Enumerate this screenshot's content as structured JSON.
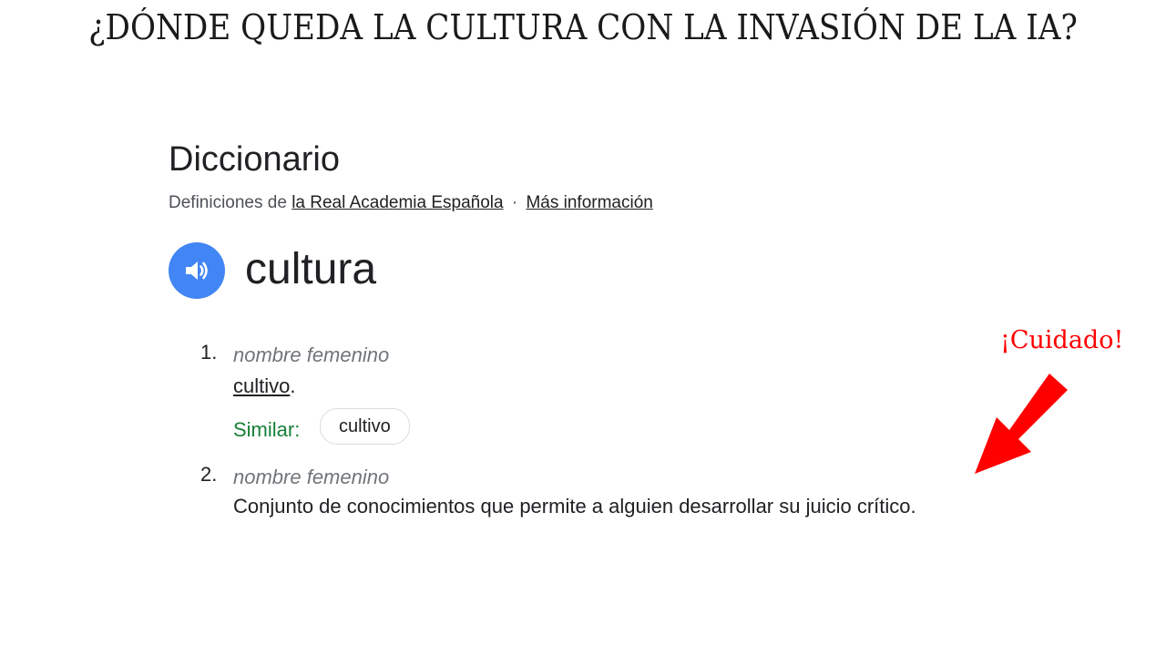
{
  "slide": {
    "title": "¿DÓNDE QUEDA LA CULTURA CON LA INVASIÓN DE LA IA?"
  },
  "dictionary": {
    "heading": "Diccionario",
    "source_prefix": "Definiciones de",
    "source_link": "la Real Academia Española",
    "separator": "·",
    "more_info_link": "Más información",
    "audio_icon": "speaker-icon",
    "audio_color": "#4285f4",
    "word": "cultura",
    "senses": [
      {
        "number": "1.",
        "part_of_speech": "nombre femenino",
        "definition_link": "cultivo",
        "definition_suffix": ".",
        "similar_label": "Similar:",
        "similar_chip": "cultivo"
      },
      {
        "number": "2.",
        "part_of_speech": "nombre femenino",
        "definition": "Conjunto de conocimientos que permite a alguien desarrollar su juicio crítico."
      }
    ]
  },
  "annotation": {
    "label": "¡Cuidado!",
    "color": "#ff0000",
    "arrow_icon": "arrow-down-left-icon"
  }
}
